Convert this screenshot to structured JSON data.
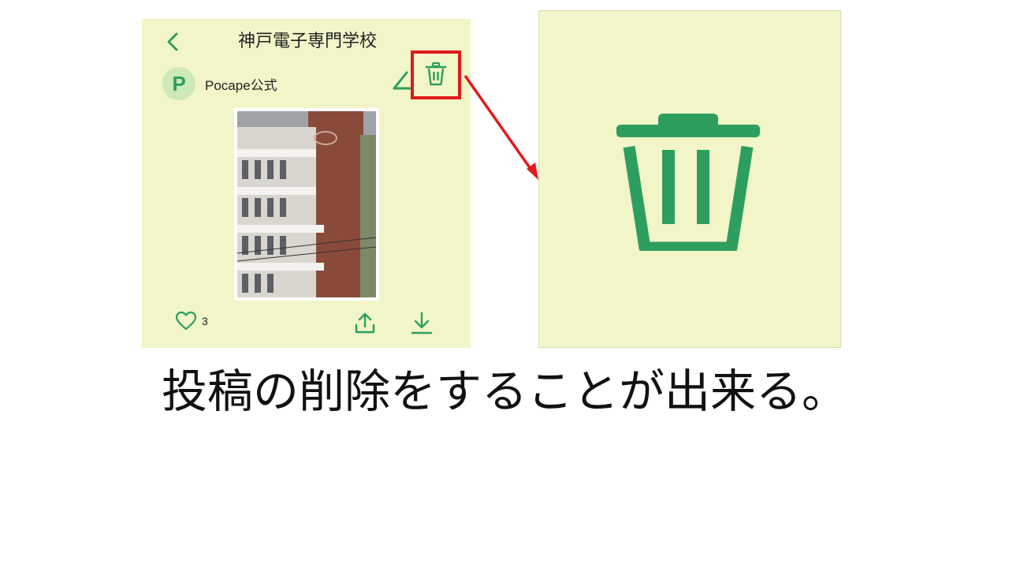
{
  "header": {
    "title": "神戸電子専門学校"
  },
  "post": {
    "author_name": "Pocape公式",
    "avatar_letter": "P",
    "like_count": "3"
  },
  "icons": {
    "back": "chevron-left-icon",
    "edit": "pencil-icon",
    "delete": "trash-icon",
    "like": "heart-icon",
    "share": "share-icon",
    "download": "download-icon"
  },
  "colors": {
    "accent": "#2e9e5e",
    "app_background": "#f1f5c8",
    "highlight": "#e21a1a"
  },
  "caption": "投稿の削除をすることが出来る。"
}
